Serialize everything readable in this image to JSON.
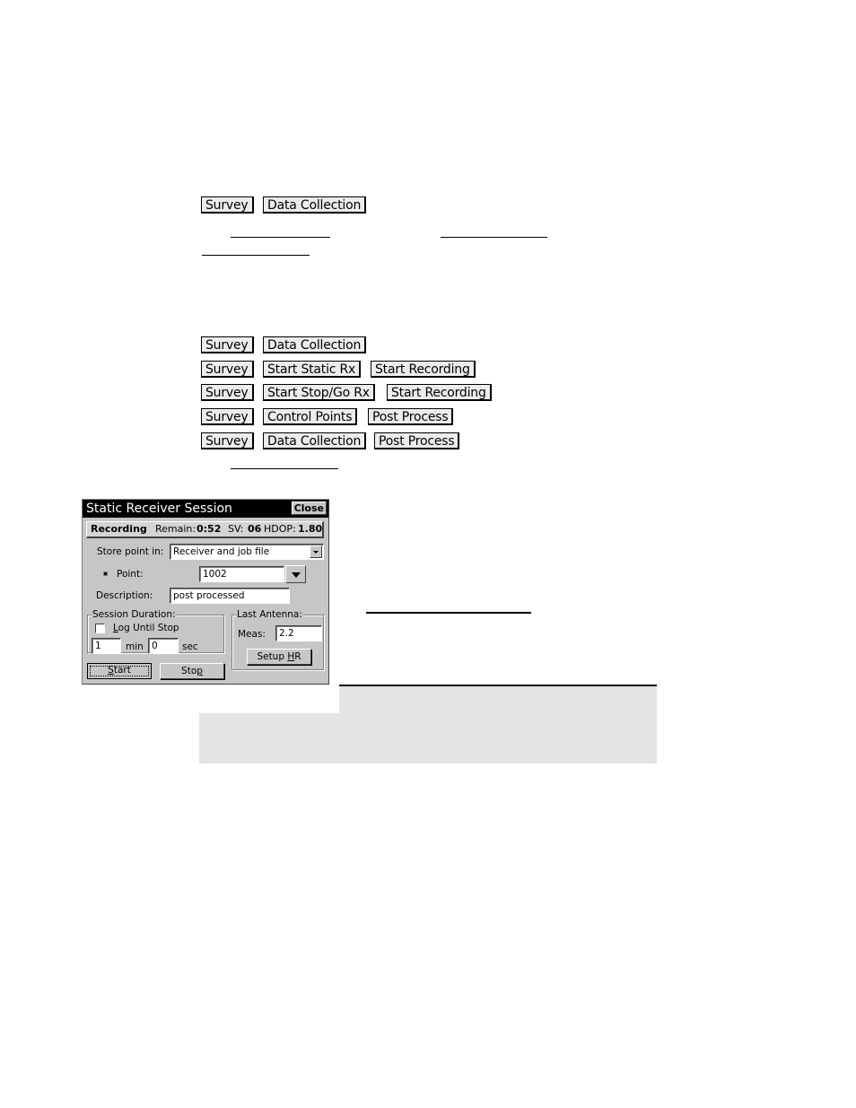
{
  "menu_path_1": {
    "items": [
      "Survey",
      "Data Collection"
    ]
  },
  "menu_paths": [
    {
      "items": [
        "Survey",
        "Data Collection"
      ]
    },
    {
      "items": [
        "Survey",
        "Start Static Rx",
        "Start Recording"
      ]
    },
    {
      "items": [
        "Survey",
        "Start Stop/Go Rx",
        "Start Recording"
      ]
    },
    {
      "items": [
        "Survey",
        "Control Points",
        "Post Process"
      ]
    },
    {
      "items": [
        "Survey",
        "Data Collection",
        "Post Process"
      ]
    }
  ],
  "dialog": {
    "title": "Static Receiver Session",
    "close_label": "Close",
    "status": {
      "state": "Recording",
      "remain_label": "Remain:",
      "remain_value": "0:52",
      "sv_label": "SV:",
      "sv_value": "06",
      "hdop_label": "HDOP:",
      "hdop_value": "1.80"
    },
    "store_point_label": "Store point in:",
    "store_point_value": "Receiver and job file",
    "point_label": "Point:",
    "point_value": "1002",
    "description_label": "Description:",
    "description_value": "post processed",
    "session_duration": {
      "legend": "Session Duration:",
      "log_until_stop_label": "Log Until Stop",
      "log_until_stop_checked": false,
      "min_value": "1",
      "min_label": "min",
      "sec_value": "0",
      "sec_label": "sec"
    },
    "last_antenna": {
      "legend": "Last Antenna:",
      "meas_label": "Meas:",
      "meas_value": "2.2",
      "setup_hr_label": "Setup HR"
    },
    "start_label": "Start",
    "stop_label": "Stop"
  },
  "colors": {
    "button_bg": "#ececec",
    "dialog_bg": "#c6c6c6",
    "note_bg": "#e4e4e4",
    "titlebar_bg": "#000000"
  }
}
